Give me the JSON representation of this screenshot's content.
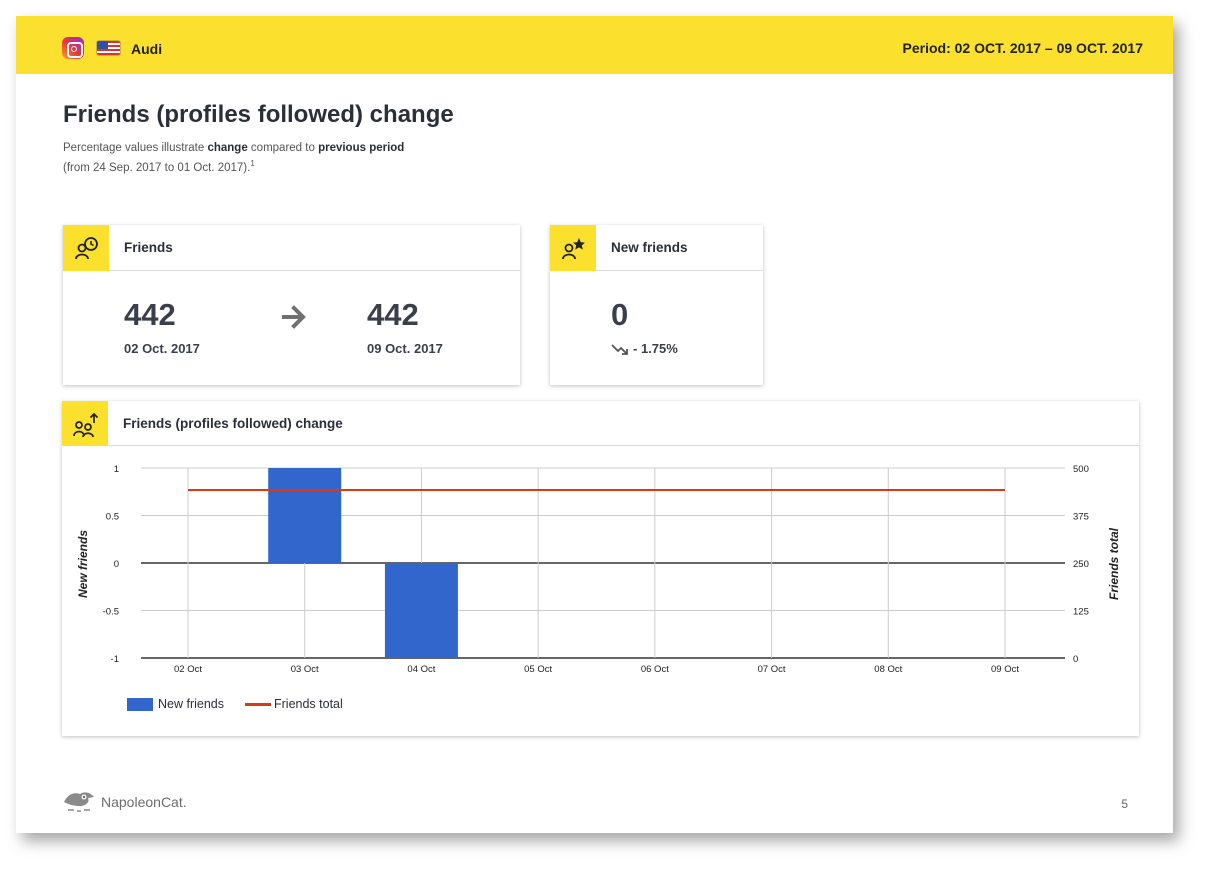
{
  "header": {
    "platform_icon": "instagram-icon",
    "flag_icon": "us-flag-icon",
    "brand": "Audi",
    "period": "Period: 02 OCT. 2017 – 09 OCT. 2017"
  },
  "title": "Friends (profiles followed) change",
  "subtitle": {
    "part1": "Percentage values illustrate ",
    "bold1": "change",
    "part2": " compared to ",
    "bold2": "previous period",
    "line2": "(from 24 Sep. 2017 to 01 Oct. 2017).",
    "footnote": "1"
  },
  "cards": {
    "friends": {
      "icon": "user-clock-icon",
      "label": "Friends",
      "from_value": "442",
      "from_date": "02 Oct. 2017",
      "arrow_icon": "arrow-right-icon",
      "to_value": "442",
      "to_date": "09 Oct. 2017"
    },
    "new_friends": {
      "icon": "user-star-icon",
      "label": "New friends",
      "value": "0",
      "trend_icon": "trend-down-icon",
      "change": "- 1.75%"
    },
    "chart": {
      "icon": "users-up-icon",
      "label": "Friends (profiles followed) change"
    }
  },
  "colors": {
    "accent": "#fbe12e",
    "bar": "#3366cc",
    "line": "#dc3912"
  },
  "chart_data": {
    "type": "bar",
    "categories": [
      "02 Oct",
      "03 Oct",
      "04 Oct",
      "05 Oct",
      "06 Oct",
      "07 Oct",
      "08 Oct",
      "09 Oct"
    ],
    "series": [
      {
        "name": "New friends",
        "type": "bar",
        "axis": "left",
        "values": [
          0,
          1,
          -1,
          0,
          0,
          0,
          0,
          0
        ]
      },
      {
        "name": "Friends total",
        "type": "line",
        "axis": "right",
        "values": [
          442,
          442,
          442,
          442,
          442,
          442,
          442,
          442
        ]
      }
    ],
    "ylabel": "New friends",
    "y2label": "Friends total",
    "ylim": [
      -1,
      1
    ],
    "y2lim": [
      0,
      500
    ],
    "yticks": [
      "1",
      "0.5",
      "0",
      "-0.5",
      "-1"
    ],
    "y2ticks": [
      "500",
      "375",
      "250",
      "125",
      "0"
    ],
    "grid": true,
    "legend": "bottom-left"
  },
  "footer": {
    "logo_icon": "napoleoncat-logo-icon",
    "brand": "NapoleonCat.",
    "page_number": "5"
  }
}
